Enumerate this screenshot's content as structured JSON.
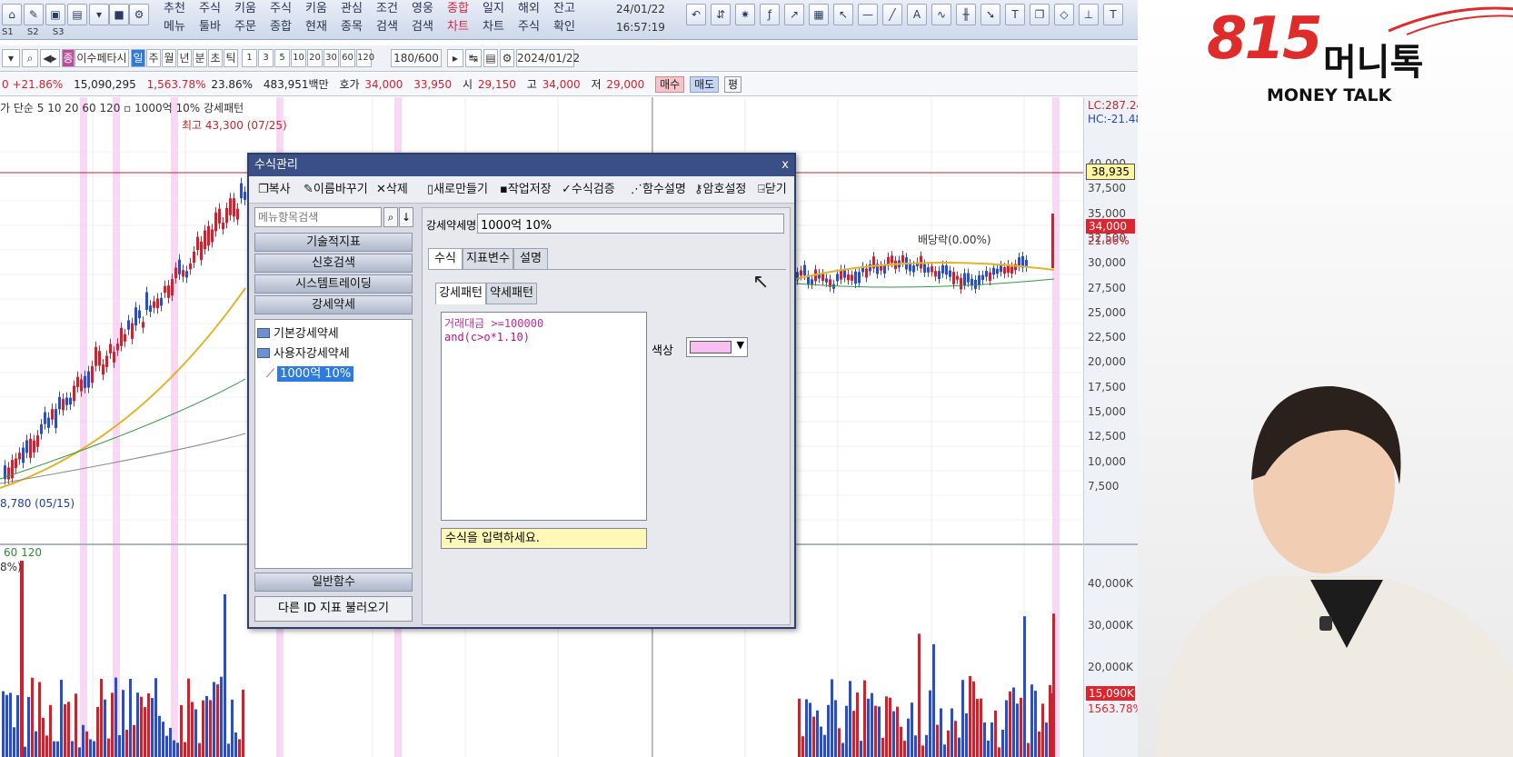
{
  "menu": {
    "items": [
      {
        "top": "추천",
        "bottom": "메뉴"
      },
      {
        "top": "주식",
        "bottom": "툴바"
      },
      {
        "top": "키움",
        "bottom": "주문"
      },
      {
        "top": "주식",
        "bottom": "종합"
      },
      {
        "top": "키움",
        "bottom": "현재"
      },
      {
        "top": "관심",
        "bottom": "종목"
      },
      {
        "top": "조건",
        "bottom": "검색"
      },
      {
        "top": "영웅",
        "bottom": "검색"
      },
      {
        "top": "종합",
        "bottom": "차트"
      },
      {
        "top": "일지",
        "bottom": "차트"
      },
      {
        "top": "해외",
        "bottom": "주식"
      },
      {
        "top": "잔고",
        "bottom": "확인"
      }
    ],
    "date": "24/01/22",
    "time": "16:57:19",
    "sub": [
      "S1",
      "S2",
      "S3"
    ]
  },
  "toolbar2": {
    "stock_name": "이수페타시",
    "periods": [
      "일",
      "주",
      "월",
      "년",
      "분",
      "초",
      "틱"
    ],
    "nums": [
      "1",
      "3",
      "5",
      "10",
      "20",
      "30",
      "60",
      "120"
    ],
    "count": "180/600",
    "date": "2024/01/22"
  },
  "quote": {
    "change": "0 +21.86%",
    "volume": "15,090,295",
    "vol_ratio": "1,563.78%",
    "rate": "23.86%",
    "amount": "483,951백만",
    "ask_label": "호가",
    "ask": "34,000",
    "bid": "33,950",
    "open_label": "시",
    "open": "29,150",
    "high_label": "고",
    "high": "34,000",
    "low_label": "저",
    "low": "29,000",
    "buy": "매수",
    "sell": "매도",
    "eval": "평"
  },
  "chart": {
    "legend": "가 단순 5  10  20  60  120 ▫ 1000억 10% 강세패턴",
    "high_label": "최고 43,300 (07/25)",
    "low_label": "8,780 (05/15)",
    "dividend_label": "배당락(0.00%)",
    "lc": "LC:287.24",
    "hc": "HC:-21.48",
    "price_ticks": [
      "40,000",
      "37,500",
      "35,000",
      "32,500",
      "30,000",
      "27,500",
      "25,000",
      "22,500",
      "20,000",
      "17,500",
      "15,000",
      "12,500",
      "10,000",
      "7,500"
    ],
    "cur_price": "38,935",
    "last_price": "34,000",
    "last_rate": "21.86%",
    "vol_legend": "60  120",
    "vol_pct": "8%)",
    "vol_ticks": [
      "40,000K",
      "30,000K",
      "20,000K"
    ],
    "vol_cur": "15,090K",
    "vol_rate": "1563.78%"
  },
  "dialog": {
    "title": "수식관리",
    "close": "x",
    "tools": [
      "복사",
      "이름바꾸기",
      "삭제",
      "새로만들기",
      "작업저장",
      "수식검증",
      "함수설명",
      "암호설정",
      "닫기"
    ],
    "search_placeholder": "메뉴항목검색",
    "categories": [
      "기술적지표",
      "신호검색",
      "시스템트레이딩",
      "강세약세"
    ],
    "tree": [
      "기본강세약세",
      "사용자강세약세",
      "1000억 10%"
    ],
    "bottom_cat": "일반함수",
    "load_btn": "다른 ID 지표 불러오기",
    "name_label": "강세약세명",
    "name_value": "1000억 10%",
    "tabs": [
      "수식",
      "지표변수",
      "설명"
    ],
    "subtabs": [
      "강세패턴",
      "약세패턴"
    ],
    "formula_line1": "거래대금 >=100000",
    "formula_line2": "and(c>o*1.10)",
    "color_label": "색상",
    "color": "#f5bff0",
    "hint": "수식을 입력하세요."
  },
  "brand": {
    "logo_num": "815",
    "logo_text": "머니톡",
    "subtitle": "MONEY TALK"
  }
}
